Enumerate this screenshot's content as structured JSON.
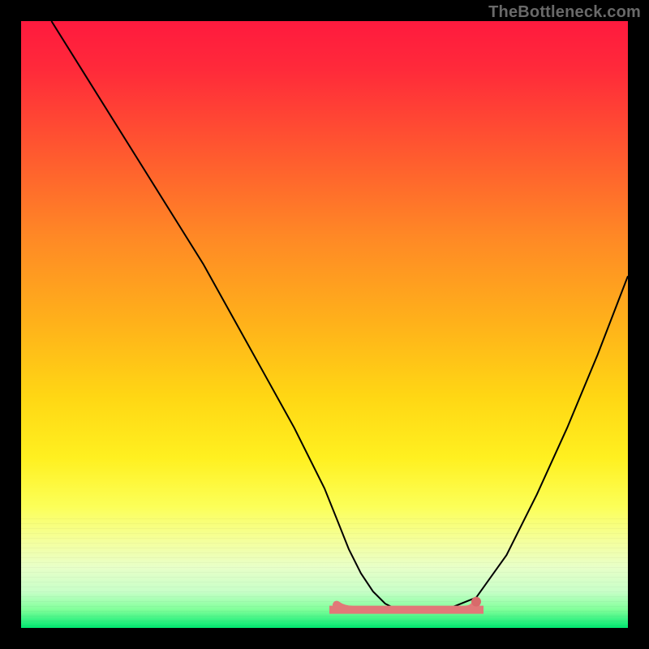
{
  "watermark": {
    "text": "TheBottleneck.com"
  },
  "colors": {
    "curve": "#000000",
    "flat_segment": "#e17878",
    "flat_endpoint": "#d86a6a"
  },
  "chart_data": {
    "type": "line",
    "title": "",
    "xlabel": "",
    "ylabel": "",
    "xlim": [
      0,
      100
    ],
    "ylim": [
      0,
      100
    ],
    "grid": false,
    "legend": false,
    "series": [
      {
        "name": "bottleneck-curve",
        "color": "#000000",
        "x": [
          5,
          10,
          15,
          20,
          25,
          30,
          35,
          40,
          45,
          50,
          52,
          54,
          56,
          58,
          60,
          62,
          64,
          70,
          75,
          80,
          85,
          90,
          95,
          100
        ],
        "y": [
          100,
          92,
          84,
          76,
          68,
          60,
          51,
          42,
          33,
          23,
          18,
          13,
          9,
          6,
          4,
          3,
          3,
          3,
          5,
          12,
          22,
          33,
          45,
          58
        ]
      }
    ],
    "flat_segment": {
      "name": "optimal-range",
      "color": "#e17878",
      "x_start": 52,
      "x_end": 75,
      "y": 3
    }
  }
}
